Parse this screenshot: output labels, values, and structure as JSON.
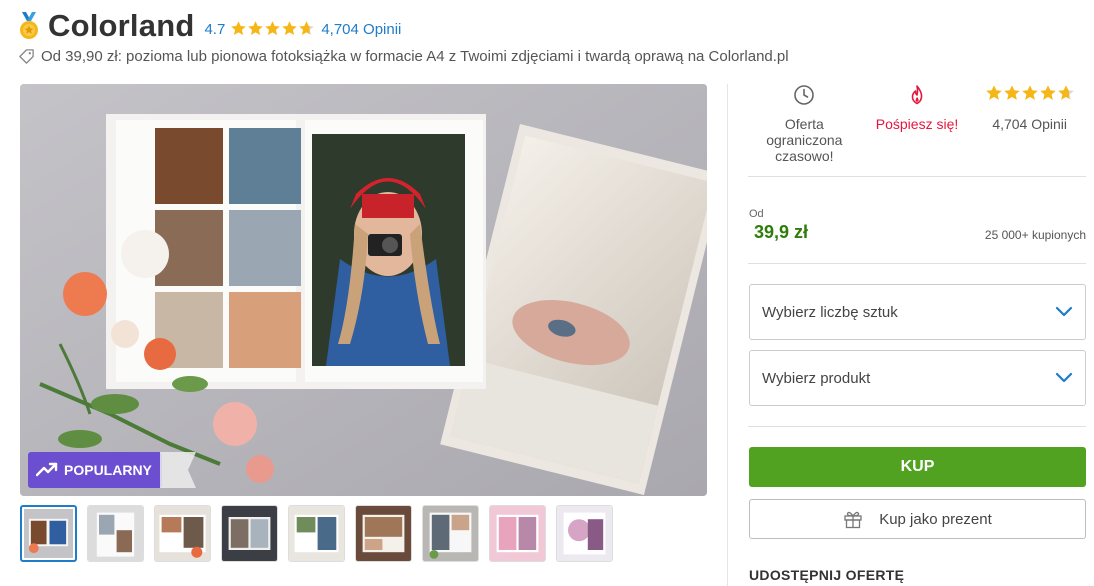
{
  "header": {
    "brand": "Colorland",
    "rating": "4.7",
    "stars_value": 4.7,
    "reviews_link": "4,704 Opinii",
    "subtitle": "Od 39,90 zł: pozioma lub pionowa fotoksiążka w formacie A4 z Twoimi zdjęciami i twardą oprawą na Colorland.pl"
  },
  "hero": {
    "badge_label": "POPULARNY",
    "badge_color": "#6c4fd0"
  },
  "thumbnails": {
    "count": 9,
    "active_index": 0
  },
  "features": [
    {
      "icon": "clock-icon",
      "label": "Oferta ograniczona czasowo!"
    },
    {
      "icon": "flame-icon",
      "label": "Pośpiesz się!"
    },
    {
      "icon": "stars-icon",
      "label": "4,704 Opinii"
    }
  ],
  "price": {
    "label": "Od",
    "value": "39,9 zł",
    "sold": "25 000+ kupionych",
    "color": "#2f7d0b"
  },
  "selects": {
    "quantity": "Wybierz liczbę sztuk",
    "product": "Wybierz produkt"
  },
  "actions": {
    "buy": "KUP",
    "gift": "Kup jako prezent",
    "buy_color": "#52a222"
  },
  "share": {
    "label": "UDOSTĘPNIJ OFERTĘ"
  },
  "colors": {
    "link": "#1e7cc8",
    "star": "#f5b718",
    "hurry": "#e3173e"
  }
}
